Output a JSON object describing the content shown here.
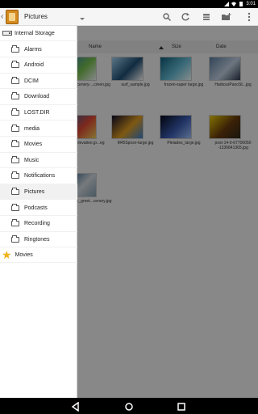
{
  "status_bar": {
    "time": "3:01",
    "icons": [
      "signal-icon",
      "wifi-icon",
      "battery-icon"
    ]
  },
  "app_bar": {
    "title": "Pictures",
    "actions": [
      "search-icon",
      "refresh-icon",
      "view-icon",
      "new-folder-icon",
      "overflow-menu-icon"
    ]
  },
  "columns": {
    "name": "Name",
    "size": "Size",
    "date": "Date"
  },
  "files": [
    {
      "label": "...uliScenery-...creen.jpg",
      "colors": [
        "#2f7eb9",
        "#79c34f",
        "#f4f6fa"
      ]
    },
    {
      "label": "surf_sample.jpg",
      "colors": [
        "#a7d8f4",
        "#1f4f74",
        "#ffffff"
      ]
    },
    {
      "label": "frozen-super large.jpg",
      "colors": [
        "#0d5f7c",
        "#69c0da",
        "#f0ffff"
      ]
    },
    {
      "label": "HarbourPanoSt...jpg",
      "colors": [
        "#5e7fa1",
        "#c7d6e8",
        "#2f3c50"
      ]
    },
    {
      "label": "...elevation.jp...eg",
      "colors": [
        "#1f5fa8",
        "#e44b35",
        "#f2d35a"
      ]
    },
    {
      "label": "M45Spicer-large.jpg",
      "colors": [
        "#0e0d2e",
        "#e6a122",
        "#3b84d8"
      ]
    },
    {
      "label": "Pleiades_large.jpg",
      "colors": [
        "#040818",
        "#3b5fb7",
        "#a6c6ff"
      ]
    },
    {
      "label": "post-14-0-67700050 -1336841365.jpg",
      "colors": [
        "#f0d000",
        "#6a3b0f",
        "#2c2a18"
      ]
    },
    {
      "label": "...oasic_greet...cenery.jpg",
      "colors": [
        "#1a4d76",
        "#d7dfe5",
        "#86a0b2"
      ]
    }
  ],
  "drawer": {
    "storage_label": "Internal Storage",
    "folders": [
      "Alarms",
      "Android",
      "DCIM",
      "Download",
      "LOST.DIR",
      "media",
      "Movies",
      "Music",
      "Notifications",
      "Pictures",
      "Podcasts",
      "Recording",
      "Ringtones"
    ],
    "selected": "Pictures",
    "bookmark_label": "Movies",
    "bookmark_icon": "star-icon"
  },
  "nav_bar": {
    "buttons": [
      "back-icon",
      "home-icon",
      "recents-icon"
    ]
  }
}
